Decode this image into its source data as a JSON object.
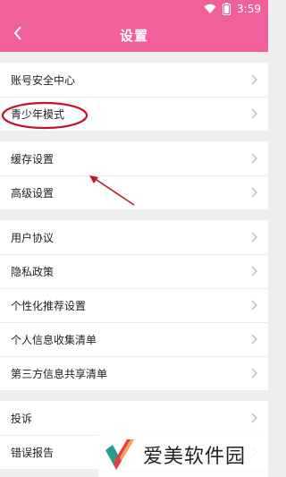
{
  "status": {
    "time": "3:59"
  },
  "header": {
    "title": "设置"
  },
  "sections": [
    {
      "items": [
        {
          "label": "账号安全中心"
        },
        {
          "label": "青少年模式"
        }
      ]
    },
    {
      "items": [
        {
          "label": "缓存设置"
        },
        {
          "label": "高级设置"
        }
      ]
    },
    {
      "items": [
        {
          "label": "用户协议"
        },
        {
          "label": "隐私政策"
        },
        {
          "label": "个性化推荐设置"
        },
        {
          "label": "个人信息收集清单"
        },
        {
          "label": "第三方信息共享清单"
        }
      ]
    },
    {
      "items": [
        {
          "label": "投诉"
        },
        {
          "label": "错误报告"
        }
      ]
    }
  ],
  "watermark": {
    "text": "爱美软件园"
  },
  "colors": {
    "accent": "#f0609a",
    "highlight": "#c0162a"
  }
}
